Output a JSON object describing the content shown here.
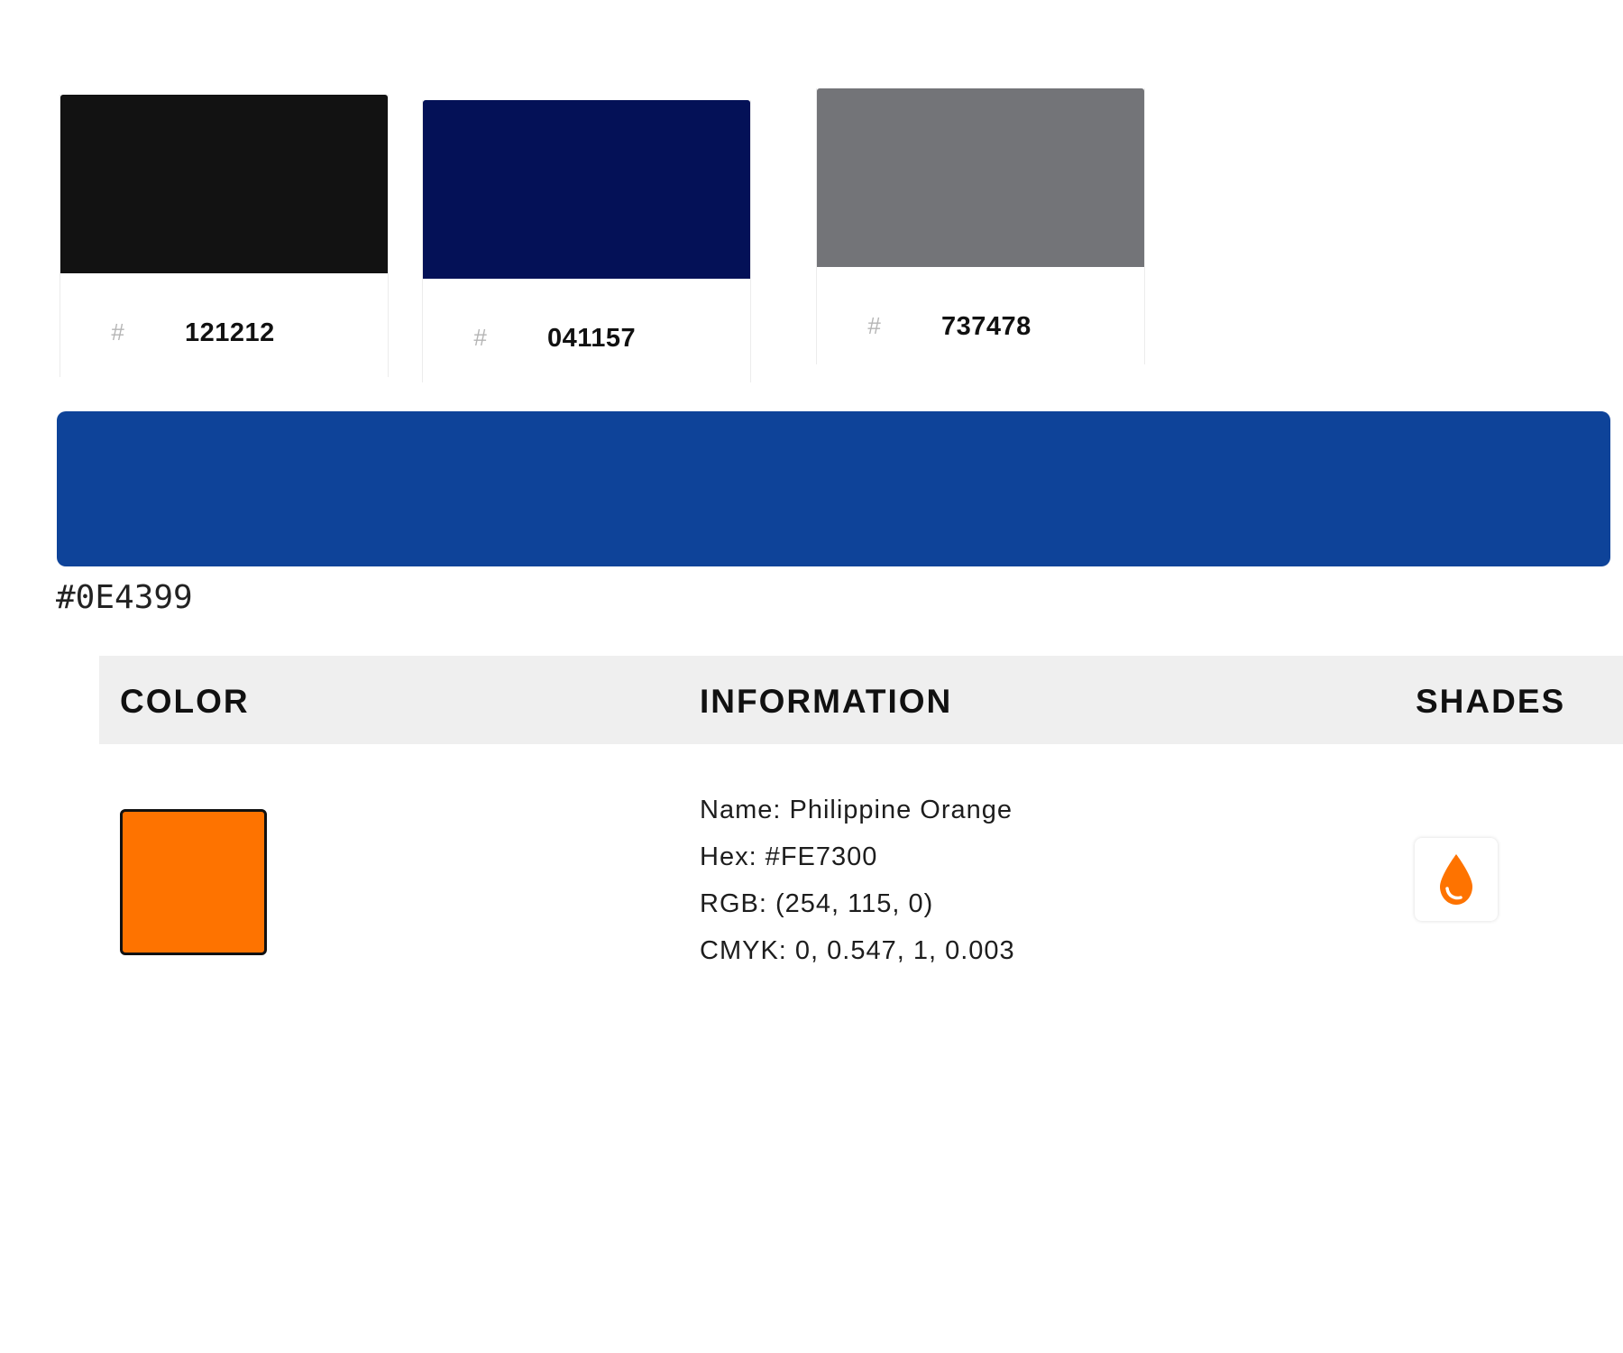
{
  "swatches": [
    {
      "hash": "#",
      "code": "121212",
      "color": "#121212"
    },
    {
      "hash": "#",
      "code": "041157",
      "color": "#041157"
    },
    {
      "hash": "#",
      "code": "737478",
      "color": "#737478"
    }
  ],
  "primary": {
    "label": "#0E4399",
    "color": "#0E4399"
  },
  "table": {
    "headers": {
      "color": "COLOR",
      "information": "INFORMATION",
      "shades": "SHADES"
    },
    "row": {
      "swatch_color": "#FE7300",
      "name": "Name: Philippine Orange",
      "hex": "Hex: #FE7300",
      "rgb": "RGB: (254, 115, 0)",
      "cmyk": "CMYK: 0, 0.547, 1, 0.003",
      "shades_icon": "droplet-icon"
    }
  }
}
